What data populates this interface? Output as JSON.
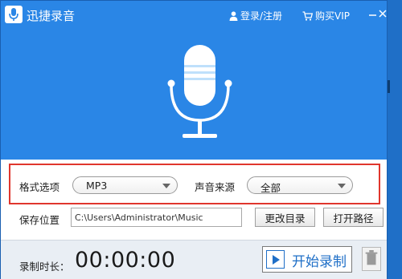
{
  "window": {
    "title": "迅捷录音",
    "login_label": "登录/注册",
    "vip_label": "购买VIP"
  },
  "format_panel": {
    "format_label": "格式选项",
    "format_value": "MP3",
    "source_label": "声音来源",
    "source_value": "全部"
  },
  "save": {
    "label": "保存位置",
    "path_value": "C:\\Users\\Administrator\\Music",
    "change_button": "更改目录",
    "open_button": "打开路径"
  },
  "recording": {
    "duration_label": "录制时长：",
    "duration_value": "00:00:00",
    "start_button": "开始录制"
  },
  "colors": {
    "accent": "#2a86e6",
    "highlight_border": "#e0362d"
  },
  "icons": [
    "microphone-icon",
    "user-icon",
    "cart-icon",
    "minimize-icon",
    "close-icon",
    "play-icon",
    "trash-icon"
  ]
}
